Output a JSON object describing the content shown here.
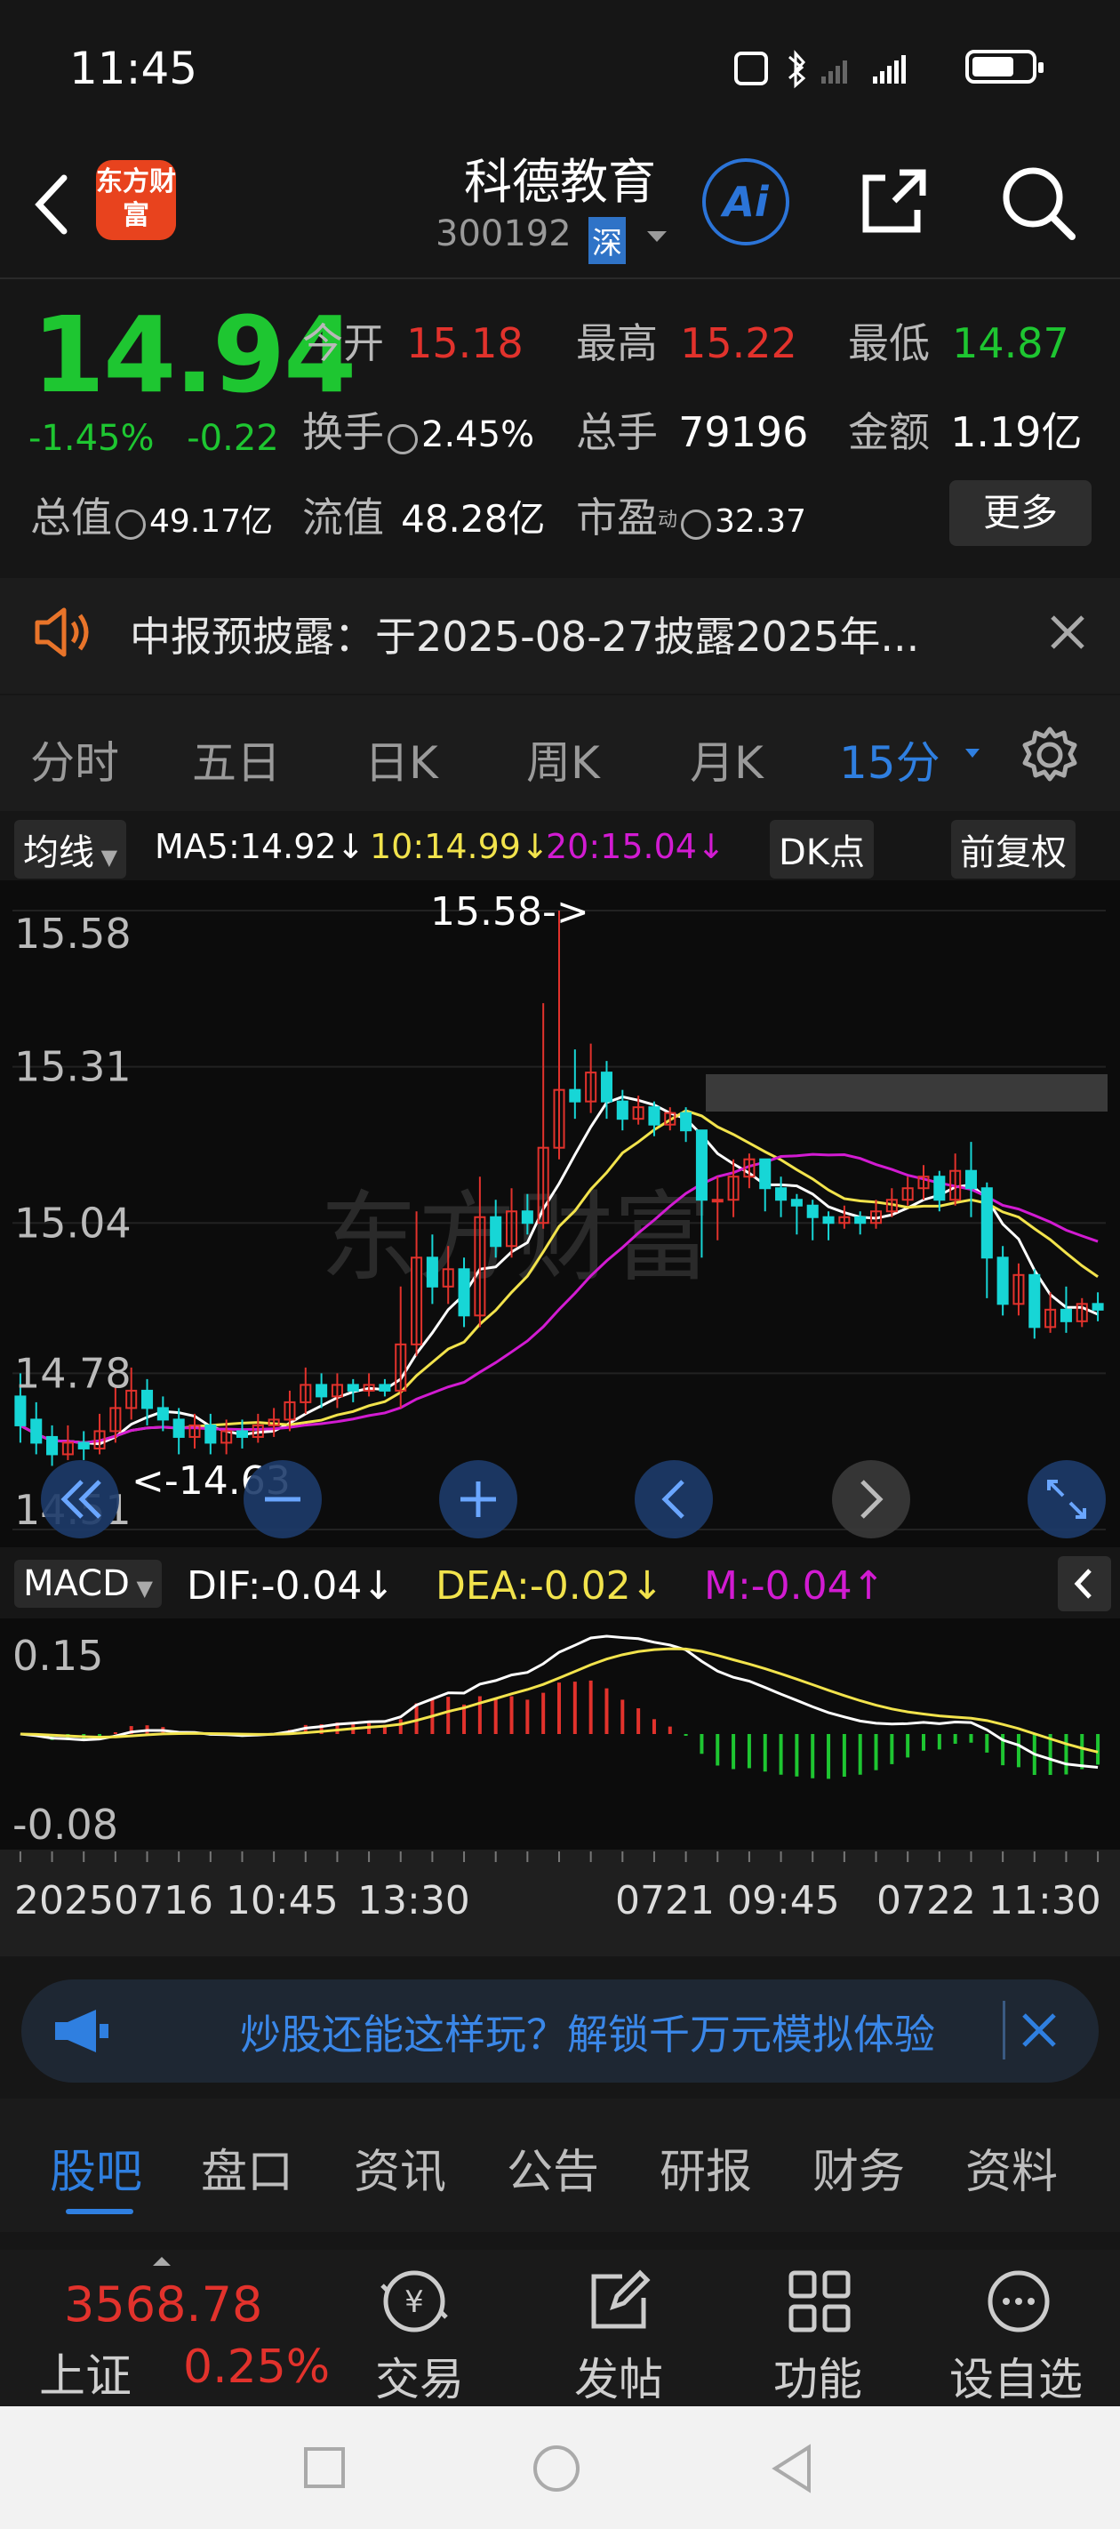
{
  "status_bar": {
    "time": "11:45"
  },
  "header": {
    "title": "科德教育",
    "code": "300192",
    "market": "深",
    "logo_text": "东方财富",
    "ai_label": "Ai"
  },
  "quote": {
    "price": "14.94",
    "change_pct": "-1.45%",
    "change": "-0.22",
    "open_label": "今开",
    "open": "15.18",
    "high_label": "最高",
    "high": "15.22",
    "low_label": "最低",
    "low": "14.87",
    "turnover_label": "换手",
    "turnover": "2.45%",
    "volume_label": "总手",
    "volume": "79196",
    "amount_label": "金额",
    "amount": "1.19亿",
    "total_cap_label": "总值",
    "total_cap": "49.17亿",
    "float_cap_label": "流值",
    "float_cap": "48.28亿",
    "pe_label": "市盈",
    "pe_sup": "动",
    "pe": "32.37",
    "more_label": "更多"
  },
  "notice": {
    "text": "中报预披露：于2025-08-27披露2025年..."
  },
  "period_tabs": [
    "分时",
    "五日",
    "日K",
    "周K",
    "月K",
    "15分"
  ],
  "active_period": "15分",
  "ma_bar": {
    "selector": "均线",
    "ma5": "MA5:14.92↓",
    "ma10": "10:14.99↓",
    "ma20": "20:15.04↓",
    "dk": "DK点",
    "adjust": "前复权"
  },
  "colors": {
    "up": "#e2322c",
    "down": "#1ec631",
    "candle_down": "#17d6d6",
    "ma5": "#ffffff",
    "ma10": "#f2e34c",
    "ma20": "#d21bd2",
    "accent": "#2f7fe0"
  },
  "chart_data": [
    {
      "type": "candlestick",
      "y_ticks": [
        "15.58",
        "15.31",
        "15.04",
        "14.78",
        "14.51"
      ],
      "ylim": [
        14.51,
        15.58
      ],
      "annotations": [
        "15.58->",
        "<-14.63"
      ],
      "x_labels": [
        "20250716 10:45",
        "13:30",
        "0721 09:45",
        "0722 11:30"
      ],
      "candles": [
        {
          "o": 14.74,
          "c": 14.69,
          "h": 14.78,
          "l": 14.66
        },
        {
          "o": 14.7,
          "c": 14.66,
          "h": 14.73,
          "l": 14.64
        },
        {
          "o": 14.67,
          "c": 14.64,
          "h": 14.69,
          "l": 14.62
        },
        {
          "o": 14.64,
          "c": 14.66,
          "h": 14.69,
          "l": 14.63
        },
        {
          "o": 14.66,
          "c": 14.65,
          "h": 14.68,
          "l": 14.63
        },
        {
          "o": 14.65,
          "c": 14.68,
          "h": 14.71,
          "l": 14.64
        },
        {
          "o": 14.68,
          "c": 14.72,
          "h": 14.76,
          "l": 14.66
        },
        {
          "o": 14.72,
          "c": 14.75,
          "h": 14.79,
          "l": 14.7
        },
        {
          "o": 14.75,
          "c": 14.72,
          "h": 14.77,
          "l": 14.69
        },
        {
          "o": 14.72,
          "c": 14.7,
          "h": 14.74,
          "l": 14.68
        },
        {
          "o": 14.7,
          "c": 14.67,
          "h": 14.72,
          "l": 14.64
        },
        {
          "o": 14.67,
          "c": 14.69,
          "h": 14.71,
          "l": 14.65
        },
        {
          "o": 14.69,
          "c": 14.66,
          "h": 14.71,
          "l": 14.64
        },
        {
          "o": 14.66,
          "c": 14.68,
          "h": 14.7,
          "l": 14.64
        },
        {
          "o": 14.68,
          "c": 14.67,
          "h": 14.7,
          "l": 14.65
        },
        {
          "o": 14.67,
          "c": 14.69,
          "h": 14.71,
          "l": 14.66
        },
        {
          "o": 14.69,
          "c": 14.7,
          "h": 14.72,
          "l": 14.67
        },
        {
          "o": 14.7,
          "c": 14.73,
          "h": 14.75,
          "l": 14.68
        },
        {
          "o": 14.73,
          "c": 14.76,
          "h": 14.79,
          "l": 14.71
        },
        {
          "o": 14.76,
          "c": 14.74,
          "h": 14.78,
          "l": 14.72
        },
        {
          "o": 14.74,
          "c": 14.76,
          "h": 14.78,
          "l": 14.72
        },
        {
          "o": 14.76,
          "c": 14.75,
          "h": 14.77,
          "l": 14.73
        },
        {
          "o": 14.75,
          "c": 14.76,
          "h": 14.78,
          "l": 14.74
        },
        {
          "o": 14.76,
          "c": 14.75,
          "h": 14.77,
          "l": 14.74
        },
        {
          "o": 14.75,
          "c": 14.83,
          "h": 14.93,
          "l": 14.72
        },
        {
          "o": 14.83,
          "c": 14.98,
          "h": 15.06,
          "l": 14.81
        },
        {
          "o": 14.98,
          "c": 14.93,
          "h": 15.02,
          "l": 14.9
        },
        {
          "o": 14.93,
          "c": 14.96,
          "h": 15.0,
          "l": 14.9
        },
        {
          "o": 14.96,
          "c": 14.88,
          "h": 14.98,
          "l": 14.86
        },
        {
          "o": 14.88,
          "c": 15.05,
          "h": 15.12,
          "l": 14.86
        },
        {
          "o": 15.05,
          "c": 15.0,
          "h": 15.08,
          "l": 14.98
        },
        {
          "o": 15.0,
          "c": 15.06,
          "h": 15.1,
          "l": 14.98
        },
        {
          "o": 15.06,
          "c": 15.04,
          "h": 15.09,
          "l": 15.02
        },
        {
          "o": 15.04,
          "c": 15.17,
          "h": 15.42,
          "l": 15.03
        },
        {
          "o": 15.17,
          "c": 15.27,
          "h": 15.58,
          "l": 15.15
        },
        {
          "o": 15.27,
          "c": 15.25,
          "h": 15.34,
          "l": 15.22
        },
        {
          "o": 15.25,
          "c": 15.3,
          "h": 15.35,
          "l": 15.23
        },
        {
          "o": 15.3,
          "c": 15.25,
          "h": 15.32,
          "l": 15.22
        },
        {
          "o": 15.25,
          "c": 15.22,
          "h": 15.27,
          "l": 15.2
        },
        {
          "o": 15.22,
          "c": 15.24,
          "h": 15.26,
          "l": 15.21
        },
        {
          "o": 15.24,
          "c": 15.21,
          "h": 15.25,
          "l": 15.19
        },
        {
          "o": 15.21,
          "c": 15.23,
          "h": 15.24,
          "l": 15.2
        },
        {
          "o": 15.23,
          "c": 15.2,
          "h": 15.24,
          "l": 15.18
        },
        {
          "o": 15.2,
          "c": 15.08,
          "h": 15.18,
          "l": 14.98
        },
        {
          "o": 15.08,
          "c": 15.08,
          "h": 15.12,
          "l": 15.01
        },
        {
          "o": 15.08,
          "c": 15.12,
          "h": 15.15,
          "l": 15.05
        },
        {
          "o": 15.12,
          "c": 15.15,
          "h": 15.16,
          "l": 15.1
        },
        {
          "o": 15.15,
          "c": 15.1,
          "h": 15.15,
          "l": 15.06
        },
        {
          "o": 15.1,
          "c": 15.08,
          "h": 15.12,
          "l": 15.05
        },
        {
          "o": 15.08,
          "c": 15.07,
          "h": 15.09,
          "l": 15.02
        },
        {
          "o": 15.07,
          "c": 15.05,
          "h": 15.08,
          "l": 15.01
        },
        {
          "o": 15.05,
          "c": 15.04,
          "h": 15.06,
          "l": 15.01
        },
        {
          "o": 15.04,
          "c": 15.05,
          "h": 15.07,
          "l": 15.03
        },
        {
          "o": 15.05,
          "c": 15.04,
          "h": 15.06,
          "l": 15.02
        },
        {
          "o": 15.04,
          "c": 15.06,
          "h": 15.08,
          "l": 15.03
        },
        {
          "o": 15.06,
          "c": 15.08,
          "h": 15.1,
          "l": 15.05
        },
        {
          "o": 15.08,
          "c": 15.1,
          "h": 15.12,
          "l": 15.07
        },
        {
          "o": 15.1,
          "c": 15.12,
          "h": 15.14,
          "l": 15.08
        },
        {
          "o": 15.12,
          "c": 15.08,
          "h": 15.13,
          "l": 15.06
        },
        {
          "o": 15.08,
          "c": 15.13,
          "h": 15.16,
          "l": 15.07
        },
        {
          "o": 15.13,
          "c": 15.1,
          "h": 15.18,
          "l": 15.05
        },
        {
          "o": 15.1,
          "c": 14.98,
          "h": 15.11,
          "l": 14.91
        },
        {
          "o": 14.98,
          "c": 14.9,
          "h": 15.0,
          "l": 14.88
        },
        {
          "o": 14.9,
          "c": 14.95,
          "h": 14.97,
          "l": 14.88
        },
        {
          "o": 14.95,
          "c": 14.86,
          "h": 14.96,
          "l": 14.84
        },
        {
          "o": 14.86,
          "c": 14.89,
          "h": 14.92,
          "l": 14.85
        },
        {
          "o": 14.89,
          "c": 14.87,
          "h": 14.93,
          "l": 14.85
        },
        {
          "o": 14.87,
          "c": 14.9,
          "h": 14.91,
          "l": 14.86
        },
        {
          "o": 14.9,
          "c": 14.89,
          "h": 14.92,
          "l": 14.87
        }
      ]
    },
    {
      "type": "macd",
      "y_ticks": [
        "0.15",
        "-0.08"
      ],
      "ylim": [
        -0.08,
        0.15
      ],
      "dif": "DIF:-0.04↓",
      "dea": "DEA:-0.02↓",
      "m": "M:-0.04↑"
    }
  ],
  "macd_bar": {
    "selector": "MACD"
  },
  "promo": {
    "text": "炒股还能这样玩？解锁千万元模拟体验"
  },
  "bottom_tabs": [
    "股吧",
    "盘口",
    "资讯",
    "公告",
    "研报",
    "财务",
    "资料"
  ],
  "footer": {
    "index_value": "3568.78",
    "index_name": "上证",
    "index_change": "0.25%",
    "items": [
      "交易",
      "发帖",
      "功能",
      "设自选"
    ]
  }
}
